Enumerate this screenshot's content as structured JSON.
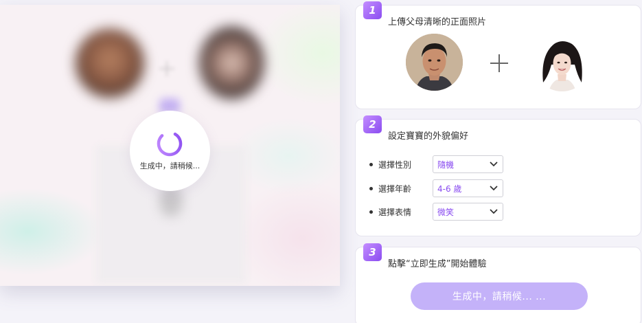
{
  "preview": {
    "loading_text": "生成中，請稍候..."
  },
  "steps": [
    {
      "number": "1",
      "title": "上傳父母清晰的正面照片"
    },
    {
      "number": "2",
      "title": "設定寶寶的外貌偏好"
    },
    {
      "number": "3",
      "title": "點擊“立即生成”開始體驗"
    }
  ],
  "preferences": [
    {
      "label": "選擇性別",
      "value": "隨機"
    },
    {
      "label": "選擇年齡",
      "value": "4-6 歲"
    },
    {
      "label": "選擇表情",
      "value": "微笑"
    }
  ],
  "generate_button": {
    "label": "生成中，請稍候... ..."
  },
  "colors": {
    "accent": "#8a4cf0",
    "button_disabled": "#c4b2f9"
  },
  "icons": {
    "spinner": "loading-spinner-icon",
    "plus": "plus-icon",
    "select_arrow": "chevron-down-icon"
  }
}
